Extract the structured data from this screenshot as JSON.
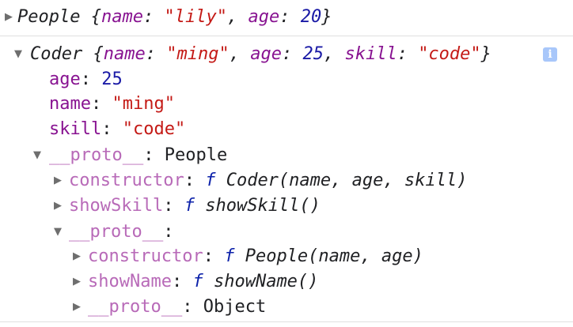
{
  "console": {
    "entries": [
      {
        "class_name": "People",
        "preview": {
          "name_key": "name",
          "name_value": "\"lily\"",
          "age_key": "age",
          "age_value": "20"
        }
      },
      {
        "class_name": "Coder",
        "preview": {
          "name_key": "name",
          "name_value": "\"ming\"",
          "age_key": "age",
          "age_value": "25",
          "skill_key": "skill",
          "skill_value": "\"code\""
        },
        "info_icon": "info-icon",
        "properties": {
          "age_key": "age",
          "age_value": "25",
          "name_key": "name",
          "name_value": "\"ming\"",
          "skill_key": "skill",
          "skill_value": "\"code\""
        },
        "proto": {
          "key": "__proto__",
          "type": "People",
          "constructor_key": "constructor",
          "constructor_value": "Coder(name, age, skill)",
          "showSkill_key": "showSkill",
          "showSkill_value": "showSkill()",
          "fn_marker": "f",
          "inner_proto": {
            "key": "__proto__",
            "constructor_key": "constructor",
            "constructor_value": "People(name, age)",
            "showName_key": "showName",
            "showName_value": "showName()",
            "deep_proto_key": "__proto__",
            "deep_proto_type": "Object"
          }
        }
      }
    ]
  }
}
